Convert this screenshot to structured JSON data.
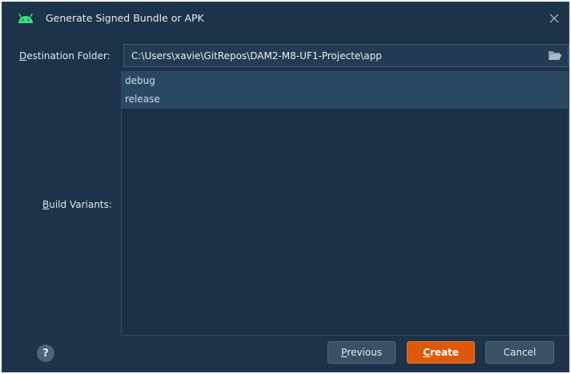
{
  "window": {
    "title": "Generate Signed Bundle or APK"
  },
  "destination": {
    "label_mnemonic": "D",
    "label_rest": "estination Folder:",
    "value": "C:\\Users\\xavie\\GitRepos\\DAM2-M8-UF1-Projecte\\app"
  },
  "build_variants": {
    "label_mnemonic": "B",
    "label_rest": "uild Variants:",
    "items": [
      {
        "label": "debug",
        "selected": true
      },
      {
        "label": "release",
        "selected": true
      }
    ]
  },
  "buttons": {
    "help_label": "?",
    "previous_mnemonic": "P",
    "previous_rest": "revious",
    "create_mnemonic": "C",
    "create_rest": "reate",
    "cancel_label": "Cancel"
  },
  "colors": {
    "background": "#1d3349",
    "accent_primary": "#dd5a0c",
    "android_green": "#3ddc84"
  },
  "icons": {
    "app": "android-icon",
    "close": "close-icon",
    "folder": "folder-open-icon",
    "help": "help-icon"
  }
}
